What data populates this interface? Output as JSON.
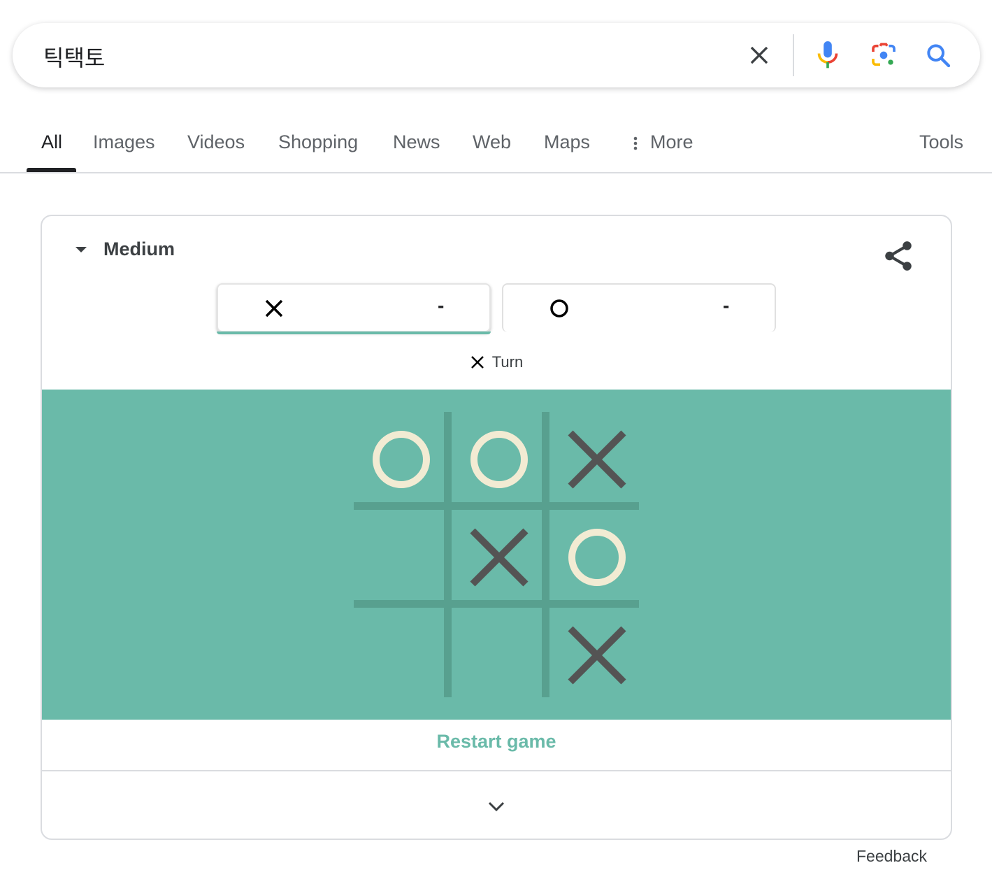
{
  "search": {
    "query": "틱택토",
    "icons": [
      "close-icon",
      "mic-icon",
      "lens-icon",
      "search-icon"
    ]
  },
  "tabs": [
    {
      "label": "All",
      "active": true
    },
    {
      "label": "Images"
    },
    {
      "label": "Videos"
    },
    {
      "label": "Shopping"
    },
    {
      "label": "News"
    },
    {
      "label": "Web"
    },
    {
      "label": "Maps"
    },
    {
      "label": "More",
      "icon": "vertical-dots-icon"
    },
    {
      "label": "Tools"
    }
  ],
  "game": {
    "difficulty": "Medium",
    "players": [
      {
        "mark": "X",
        "score": "-",
        "active": true
      },
      {
        "mark": "O",
        "score": "-",
        "active": false
      }
    ],
    "turn": {
      "mark": "X",
      "label": "Turn"
    },
    "board": [
      "O",
      "O",
      "X",
      "",
      "X",
      "O",
      "",
      "",
      "X"
    ],
    "restart_label": "Restart game",
    "colors": {
      "board_bg": "#6abaa9",
      "grid_line": "#58a08f",
      "x_mark": "#545454",
      "o_mark": "#f2ebd3",
      "accent": "#6abaa9"
    }
  },
  "footer": {
    "feedback_label": "Feedback"
  }
}
